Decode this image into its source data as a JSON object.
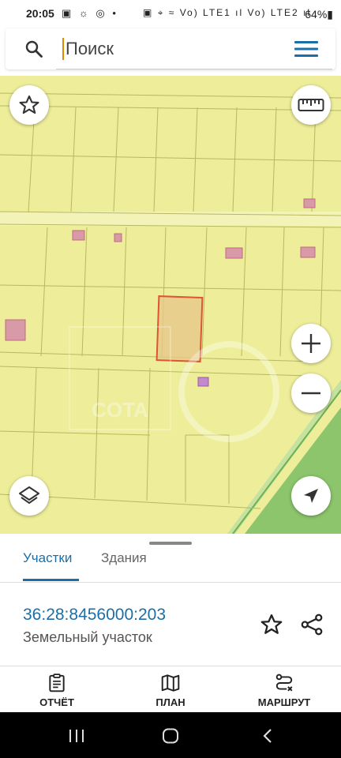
{
  "status_bar": {
    "time": "20:05",
    "left_icons": "▣ ☼ ◎ •",
    "right_icons": "▣ ⌖ ≈ Vo) LTE1 ıl Vo) LTE2 ıl",
    "battery": "64%▮"
  },
  "search": {
    "placeholder": "Поиск",
    "value": ""
  },
  "tabs": [
    {
      "label": "Участки",
      "active": true
    },
    {
      "label": "Здания",
      "active": false
    }
  ],
  "parcel": {
    "cadastral_number": "36:28:8456000:203",
    "type": "Земельный участок"
  },
  "bottom_nav": [
    {
      "label": "ОТЧЁТ",
      "icon": "report-icon"
    },
    {
      "label": "ПЛАН",
      "icon": "map-plan-icon"
    },
    {
      "label": "МАРШРУТ",
      "icon": "route-icon"
    }
  ],
  "colors": {
    "accent": "#1a6fa8",
    "map_background": "#eeee9a",
    "selected_parcel": "#dd5533",
    "building": "#d08a9a"
  }
}
